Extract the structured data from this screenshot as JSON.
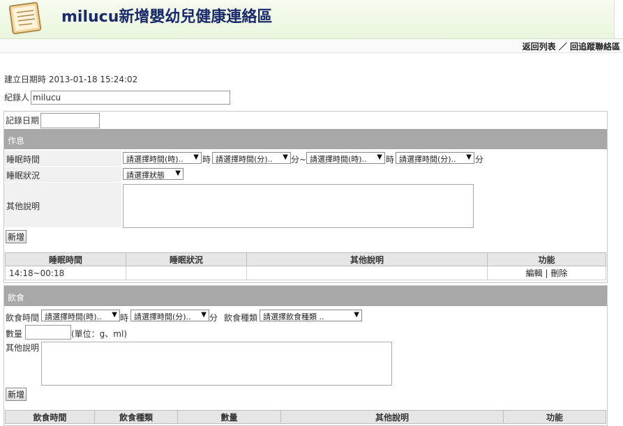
{
  "header": {
    "title": "milucu新增嬰幼兒健康連絡區",
    "logo_icon": "notepad-icon"
  },
  "nav": {
    "back_list": "返回列表",
    "separator": "／",
    "back_trace": "回追蹤聯絡區"
  },
  "meta": {
    "created_label": "建立日期時",
    "created_value": "2013-01-18 15:24:02",
    "recorder_label": "紀錄人",
    "recorder_value": "milucu"
  },
  "record_date_label": "記錄日期",
  "sleep": {
    "section_title": "作息",
    "time_label": "睡眠時間",
    "hour_start": "請選擇時間(時)..",
    "hour_unit": "時",
    "min_start": "請選擇時間(分)..",
    "min_unit_tilde": "分~",
    "hour_end": "請選擇時間(時)..",
    "hour_unit2": "時",
    "min_end": "請選擇時間(分)..",
    "min_unit2": "分",
    "status_label": "睡眠狀況",
    "status_select": "請選擇狀態",
    "note_label": "其他說明",
    "add_button": "新增",
    "table": {
      "headers": [
        "睡眠時間",
        "睡眠狀況",
        "其他說明",
        "功能"
      ],
      "rows": [
        {
          "time": "14:18~00:18",
          "status": "",
          "note": "",
          "edit": "編輯",
          "sep": "|",
          "del": "刪除"
        }
      ]
    }
  },
  "diet": {
    "section_title": "飲食",
    "time_label": "飲食時間",
    "hour_select": "請選擇時間(時)..",
    "hour_unit": "時",
    "min_select": "請選擇時間(分)..",
    "min_unit": "分",
    "type_label": "飲食種類",
    "type_select": "請選擇飲食種類 ..",
    "qty_label": "數量",
    "qty_unit": "(單位：g、ml)",
    "note_label": "其他說明",
    "add_button": "新增",
    "table_headers": [
      "飲食時間",
      "飲食種類",
      "數量",
      "其他說明",
      "功能"
    ]
  }
}
